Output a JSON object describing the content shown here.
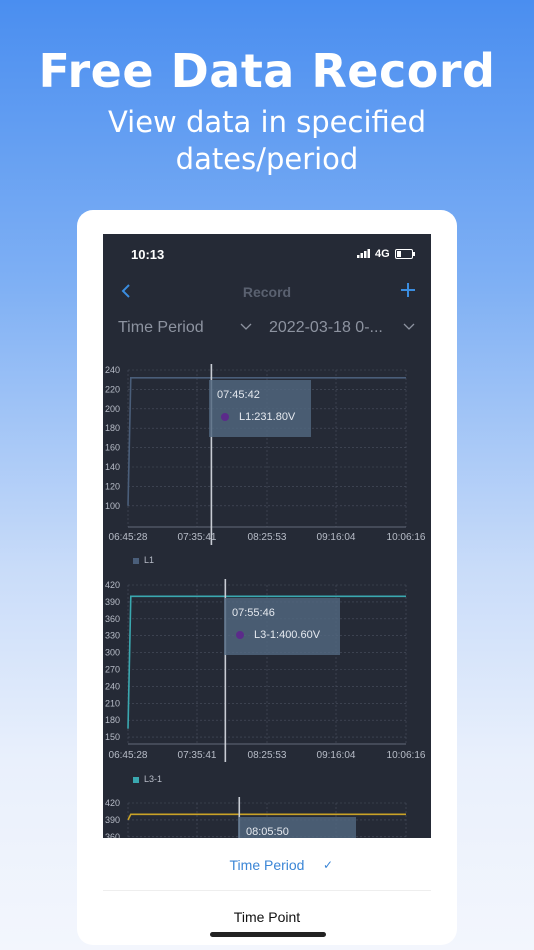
{
  "promo": {
    "headline": "Free Data Record",
    "subline_1": "View data in specified",
    "subline_2": "dates/period"
  },
  "status_bar": {
    "time": "10:13",
    "network": "4G"
  },
  "nav": {
    "title": "Record"
  },
  "filters": {
    "mode": "Time Period",
    "date": "2022-03-18 0-..."
  },
  "x_ticks": [
    "06:45:28",
    "07:35:41",
    "08:25:53",
    "09:16:04",
    "10:06:16"
  ],
  "chart_data": [
    {
      "type": "line",
      "series": [
        {
          "name": "L1",
          "color": "#4a5e7a",
          "x": [
            "06:45:28",
            "06:47:30",
            "10:06:16"
          ],
          "y": [
            100,
            232,
            232
          ]
        }
      ],
      "ylim": [
        100,
        240
      ],
      "yticks": [
        "240",
        "220",
        "200",
        "180",
        "160",
        "140",
        "120",
        "100"
      ],
      "tooltip": {
        "time": "07:45:42",
        "value": "L1:231.80V"
      }
    },
    {
      "type": "line",
      "series": [
        {
          "name": "L3-1",
          "color": "#3aa8b0",
          "x": [
            "06:45:28",
            "06:47:30",
            "10:06:16"
          ],
          "y": [
            165,
            400,
            400
          ]
        }
      ],
      "ylim": [
        150,
        420
      ],
      "yticks": [
        "420",
        "390",
        "360",
        "330",
        "300",
        "270",
        "240",
        "210",
        "180",
        "150"
      ],
      "tooltip": {
        "time": "07:55:46",
        "value": "L3-1:400.60V"
      }
    },
    {
      "type": "line",
      "series": [
        {
          "color": "#c9a227",
          "x": [
            "06:45:28",
            "06:47:30",
            "10:06:16"
          ],
          "y": [
            390,
            400,
            400
          ]
        }
      ],
      "yticks": [
        "420",
        "390",
        "360"
      ],
      "tooltip": {
        "time": "08:05:50"
      }
    }
  ],
  "sheet": {
    "option_1": "Time Period",
    "option_2": "Time Point"
  }
}
